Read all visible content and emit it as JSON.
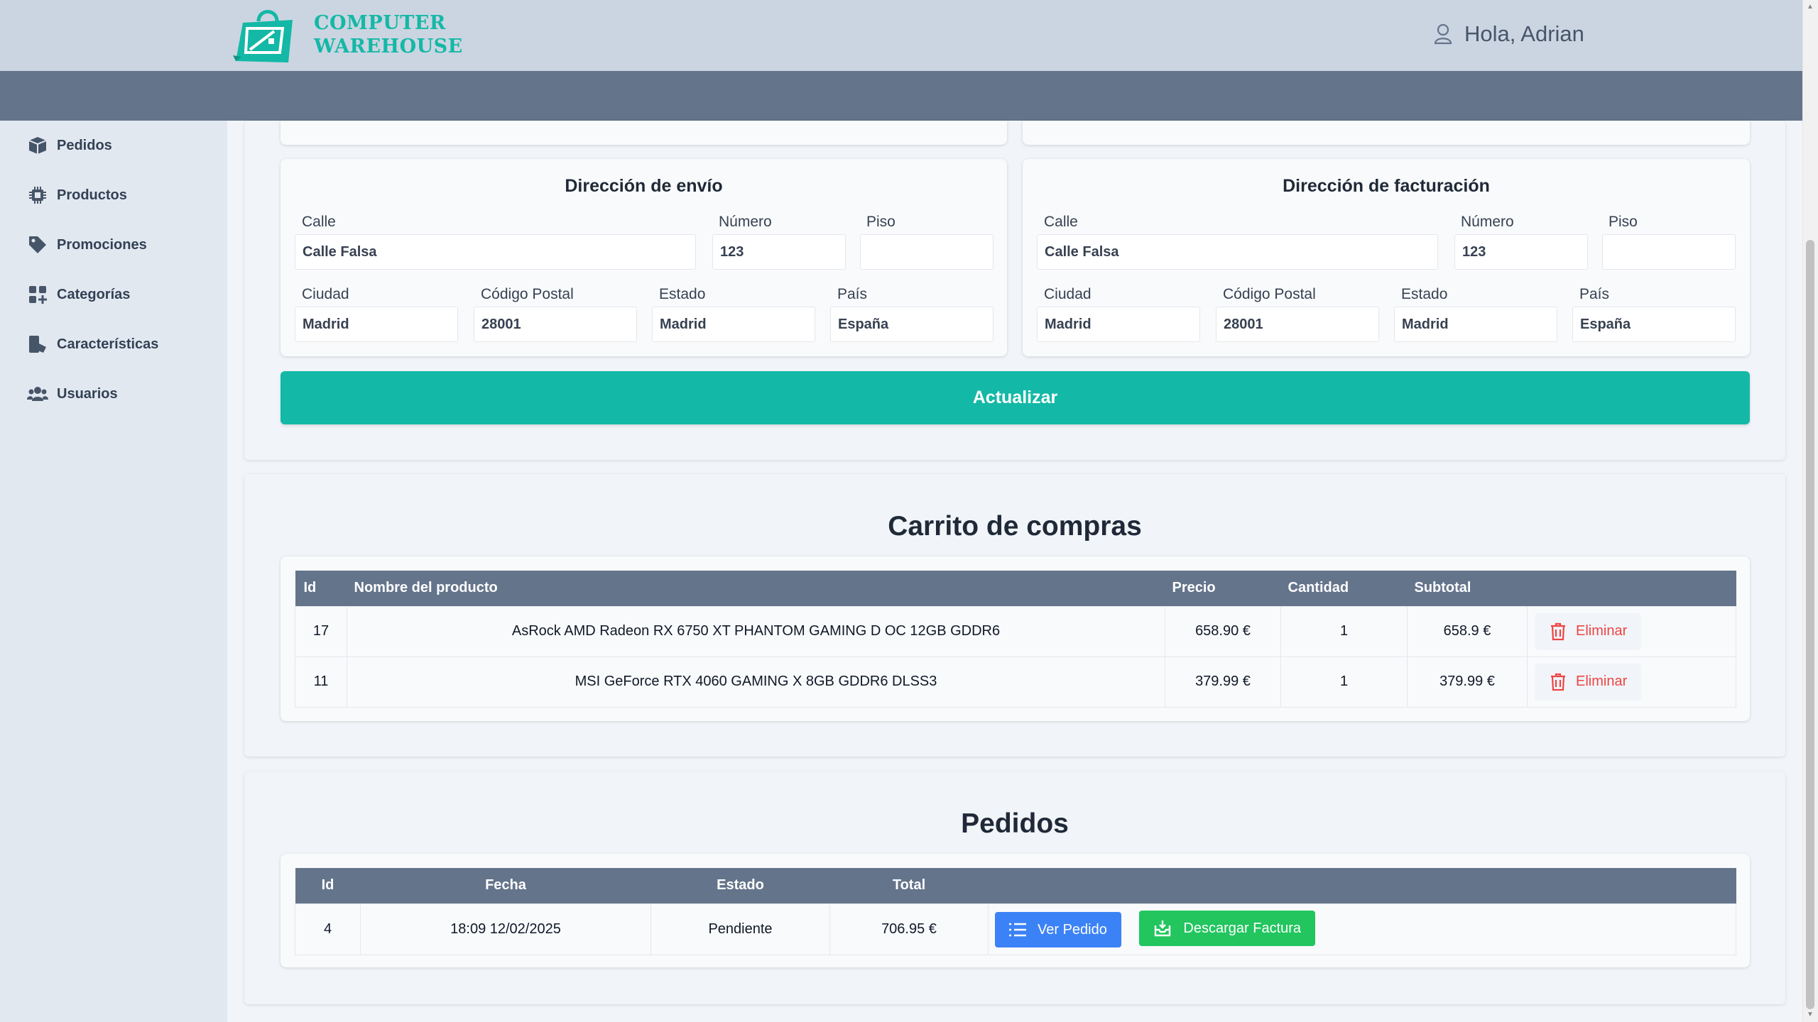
{
  "header": {
    "logo_line1": "COMPUTER",
    "logo_line2": "WAREHOUSE",
    "greeting": "Hola, Adrian",
    "accent_color": "#14b8a6"
  },
  "sidebar": {
    "items": [
      {
        "label": "Pedidos",
        "icon": "box-icon"
      },
      {
        "label": "Productos",
        "icon": "chip-icon"
      },
      {
        "label": "Promociones",
        "icon": "tag-icon"
      },
      {
        "label": "Categorías",
        "icon": "grid-plus-icon"
      },
      {
        "label": "Características",
        "icon": "specs-icon"
      },
      {
        "label": "Usuarios",
        "icon": "users-icon"
      }
    ]
  },
  "shipping": {
    "title": "Dirección de envío",
    "street_label": "Calle",
    "street": "Calle Falsa",
    "number_label": "Número",
    "number": "123",
    "floor_label": "Piso",
    "floor": "",
    "city_label": "Ciudad",
    "city": "Madrid",
    "zip_label": "Código Postal",
    "zip": "28001",
    "state_label": "Estado",
    "state": "Madrid",
    "country_label": "País",
    "country": "España"
  },
  "billing": {
    "title": "Dirección de facturación",
    "street_label": "Calle",
    "street": "Calle Falsa",
    "number_label": "Número",
    "number": "123",
    "floor_label": "Piso",
    "floor": "",
    "city_label": "Ciudad",
    "city": "Madrid",
    "zip_label": "Código Postal",
    "zip": "28001",
    "state_label": "Estado",
    "state": "Madrid",
    "country_label": "País",
    "country": "España"
  },
  "update_button": "Actualizar",
  "cart": {
    "title": "Carrito de compras",
    "columns": [
      "Id",
      "Nombre del producto",
      "Precio",
      "Cantidad",
      "Subtotal"
    ],
    "rows": [
      {
        "id": "17",
        "name": "AsRock AMD Radeon RX 6750 XT PHANTOM GAMING D OC 12GB GDDR6",
        "price": "658.90 €",
        "qty": "1",
        "subtotal": "658.9 €",
        "action": "Eliminar"
      },
      {
        "id": "11",
        "name": "MSI GeForce RTX 4060 GAMING X 8GB GDDR6 DLSS3",
        "price": "379.99 €",
        "qty": "1",
        "subtotal": "379.99 €",
        "action": "Eliminar"
      }
    ]
  },
  "orders": {
    "title": "Pedidos",
    "columns": [
      "Id",
      "Fecha",
      "Estado",
      "Total"
    ],
    "rows": [
      {
        "id": "4",
        "date": "18:09 12/02/2025",
        "status": "Pendiente",
        "total": "706.95 €",
        "view": "Ver Pedido",
        "invoice": "Descargar Factura"
      }
    ]
  }
}
